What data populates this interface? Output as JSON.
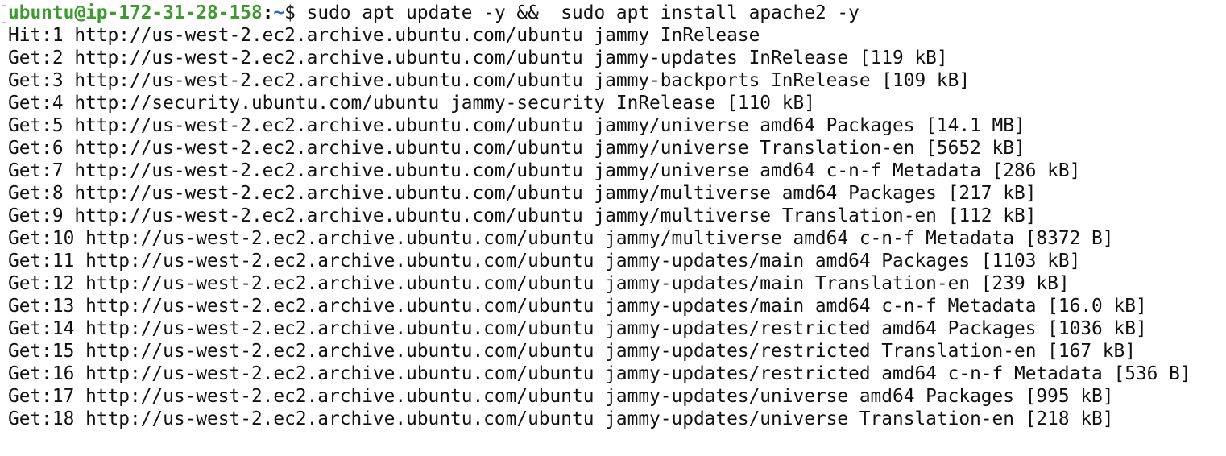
{
  "colors": {
    "prompt_user": "#3c9a2e",
    "prompt_path": "#2f63d8",
    "text": "#111111",
    "background": "#ffffff"
  },
  "prompt": {
    "user_host": "ubuntu@ip-172-31-28-158",
    "separator": ":",
    "path": "~",
    "symbol": "$",
    "command": " sudo apt update -y &&  sudo apt install apache2 -y"
  },
  "output_lines": [
    "Hit:1 http://us-west-2.ec2.archive.ubuntu.com/ubuntu jammy InRelease",
    "Get:2 http://us-west-2.ec2.archive.ubuntu.com/ubuntu jammy-updates InRelease [119 kB]",
    "Get:3 http://us-west-2.ec2.archive.ubuntu.com/ubuntu jammy-backports InRelease [109 kB]",
    "Get:4 http://security.ubuntu.com/ubuntu jammy-security InRelease [110 kB]",
    "Get:5 http://us-west-2.ec2.archive.ubuntu.com/ubuntu jammy/universe amd64 Packages [14.1 MB]",
    "Get:6 http://us-west-2.ec2.archive.ubuntu.com/ubuntu jammy/universe Translation-en [5652 kB]",
    "Get:7 http://us-west-2.ec2.archive.ubuntu.com/ubuntu jammy/universe amd64 c-n-f Metadata [286 kB]",
    "Get:8 http://us-west-2.ec2.archive.ubuntu.com/ubuntu jammy/multiverse amd64 Packages [217 kB]",
    "Get:9 http://us-west-2.ec2.archive.ubuntu.com/ubuntu jammy/multiverse Translation-en [112 kB]",
    "Get:10 http://us-west-2.ec2.archive.ubuntu.com/ubuntu jammy/multiverse amd64 c-n-f Metadata [8372 B]",
    "Get:11 http://us-west-2.ec2.archive.ubuntu.com/ubuntu jammy-updates/main amd64 Packages [1103 kB]",
    "Get:12 http://us-west-2.ec2.archive.ubuntu.com/ubuntu jammy-updates/main Translation-en [239 kB]",
    "Get:13 http://us-west-2.ec2.archive.ubuntu.com/ubuntu jammy-updates/main amd64 c-n-f Metadata [16.0 kB]",
    "Get:14 http://us-west-2.ec2.archive.ubuntu.com/ubuntu jammy-updates/restricted amd64 Packages [1036 kB]",
    "Get:15 http://us-west-2.ec2.archive.ubuntu.com/ubuntu jammy-updates/restricted Translation-en [167 kB]",
    "Get:16 http://us-west-2.ec2.archive.ubuntu.com/ubuntu jammy-updates/restricted amd64 c-n-f Metadata [536 B]",
    "Get:17 http://us-west-2.ec2.archive.ubuntu.com/ubuntu jammy-updates/universe amd64 Packages [995 kB]",
    "Get:18 http://us-west-2.ec2.archive.ubuntu.com/ubuntu jammy-updates/universe Translation-en [218 kB]"
  ]
}
